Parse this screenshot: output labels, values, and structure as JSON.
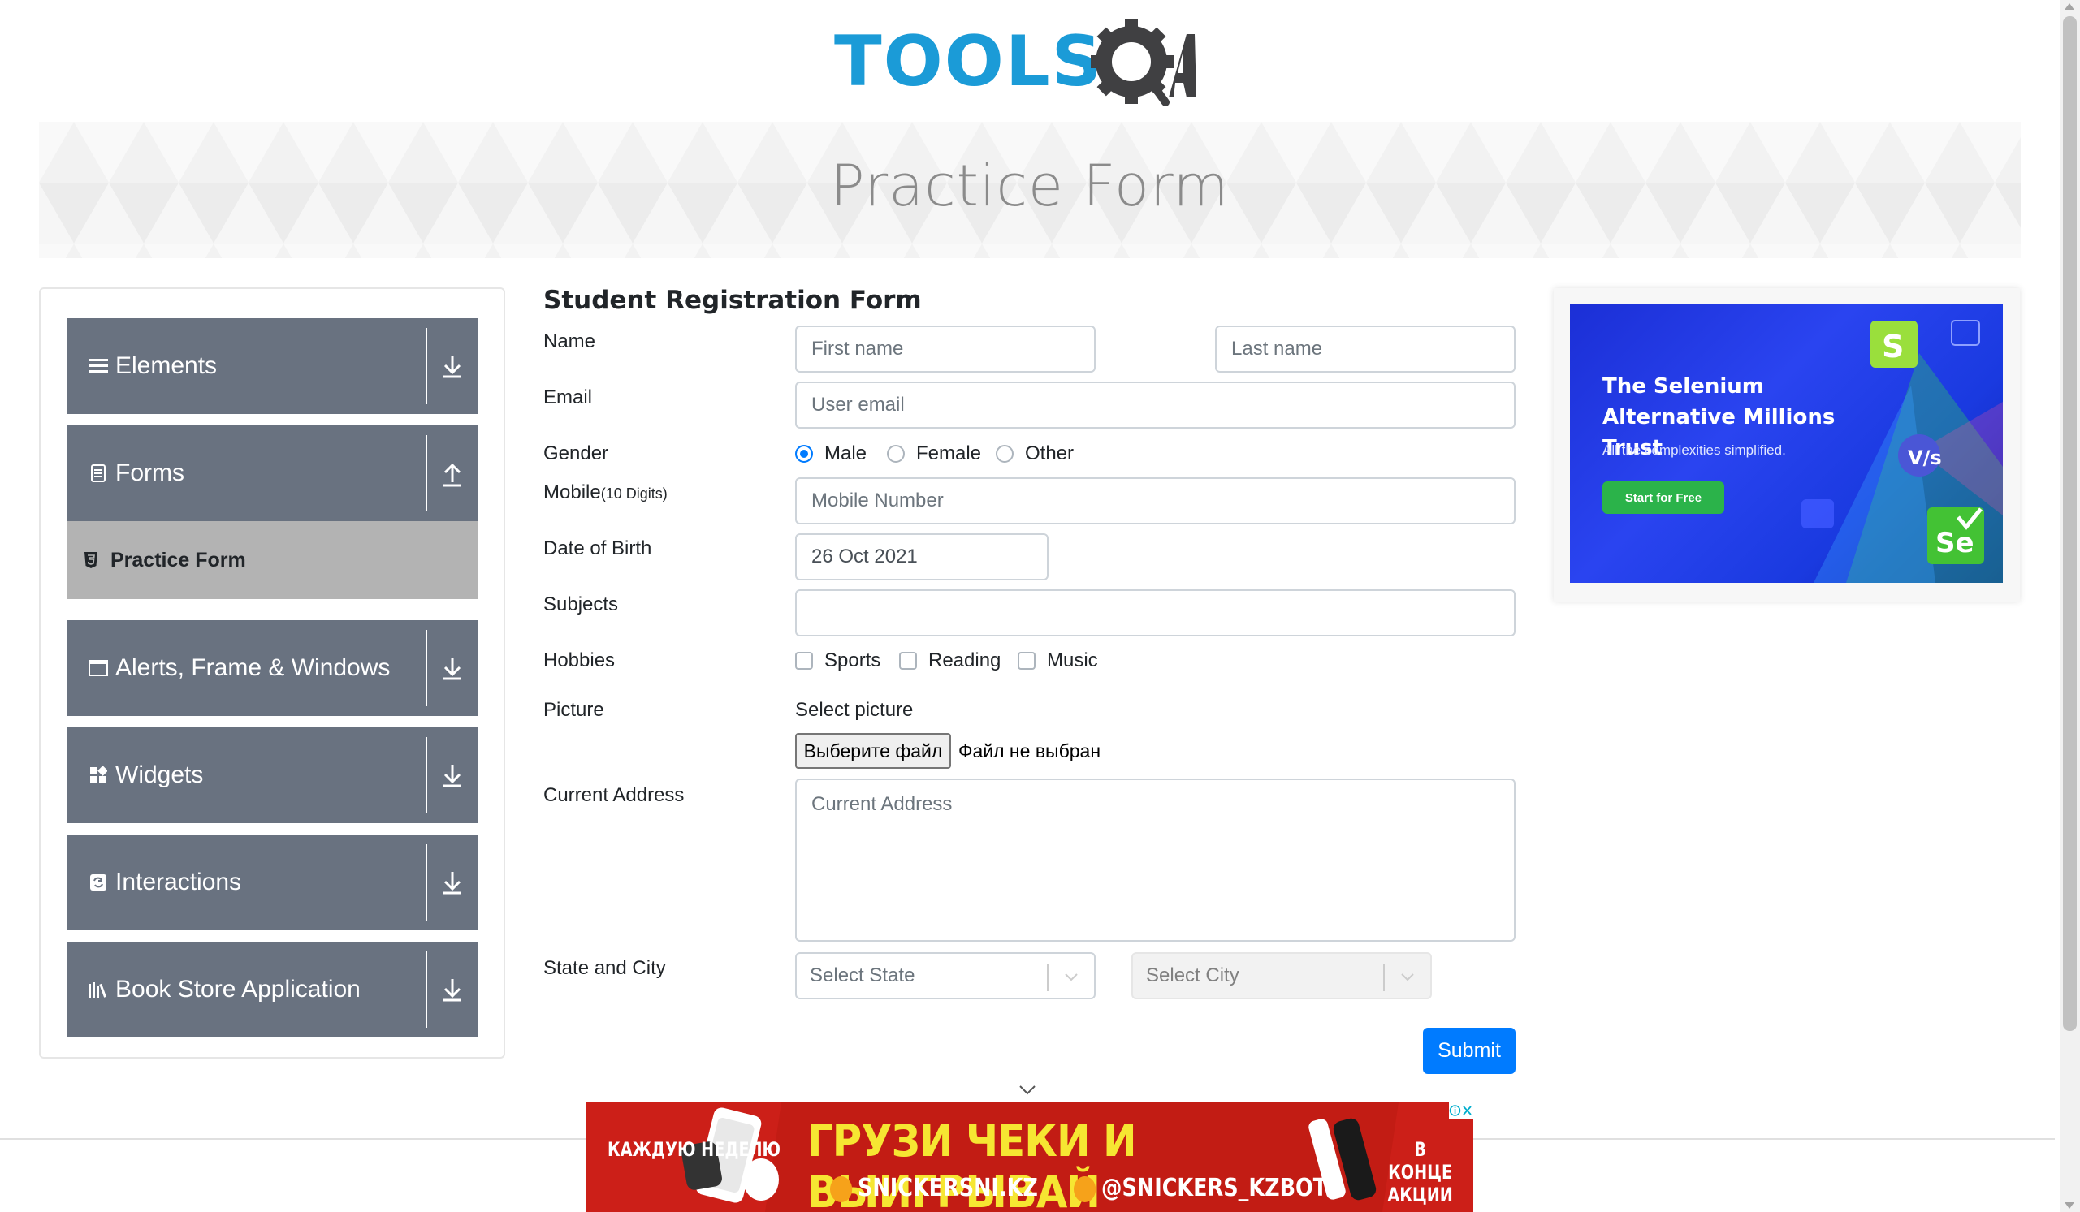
{
  "logo": {
    "text": "TOOLS",
    "qa": "QA"
  },
  "banner": {
    "title": "Practice Form"
  },
  "sidebar": {
    "groups": [
      {
        "label": "Elements",
        "icon": "hamburger-icon",
        "arrow": "download-icon"
      },
      {
        "label": "Forms",
        "icon": "document-icon",
        "arrow": "upload-icon"
      },
      {
        "label": "Alerts, Frame & Windows",
        "icon": "window-icon",
        "arrow": "download-icon"
      },
      {
        "label": "Widgets",
        "icon": "widgets-icon",
        "arrow": "download-icon"
      },
      {
        "label": "Interactions",
        "icon": "interactions-icon",
        "arrow": "download-icon"
      },
      {
        "label": "Book Store Application",
        "icon": "books-icon",
        "arrow": "download-icon"
      }
    ],
    "active_item": {
      "label": "Practice Form",
      "icon": "html5-icon"
    }
  },
  "form": {
    "title": "Student Registration Form",
    "labels": {
      "name": "Name",
      "email": "Email",
      "gender": "Gender",
      "mobile": "Mobile",
      "mobile_hint": "(10 Digits)",
      "dob": "Date of Birth",
      "subjects": "Subjects",
      "hobbies": "Hobbies",
      "picture": "Picture",
      "address": "Current Address",
      "state_city": "State and City"
    },
    "first_name_placeholder": "First name",
    "last_name_placeholder": "Last name",
    "email_placeholder": "User email",
    "gender_options": [
      "Male",
      "Female",
      "Other"
    ],
    "gender_selected": "Male",
    "mobile_placeholder": "Mobile Number",
    "dob_value": "26 Oct 2021",
    "subjects_value": "",
    "hobbies": [
      "Sports",
      "Reading",
      "Music"
    ],
    "picture_label": "Select picture",
    "file_button": "Выберите файл",
    "file_status": "Файл не выбран",
    "address_placeholder": "Current Address",
    "state_placeholder": "Select State",
    "city_placeholder": "Select City",
    "submit": "Submit"
  },
  "ad_right": {
    "headline": "The Selenium Alternative Millions Trust",
    "subtext": "All the complexities simplified.",
    "button": "Start for Free",
    "brand_colors": {
      "bg": "#1b2fd6",
      "button": "#2bb34a"
    }
  },
  "ad_bottom": {
    "main": "ГРУЗИ ЧЕКИ И ВЫИГРЫВАЙ",
    "site": "SNICKERSNI.KZ",
    "bot": "@SNICKERS_KZBOT",
    "left": "КАЖДУЮ НЕДЕЛЮ",
    "right": "В КОНЦЕ АКЦИИ"
  },
  "colors": {
    "accent": "#007bff",
    "sidebar": "#697280",
    "active": "#b3b3b3",
    "logo_blue": "#1b9bd7"
  }
}
